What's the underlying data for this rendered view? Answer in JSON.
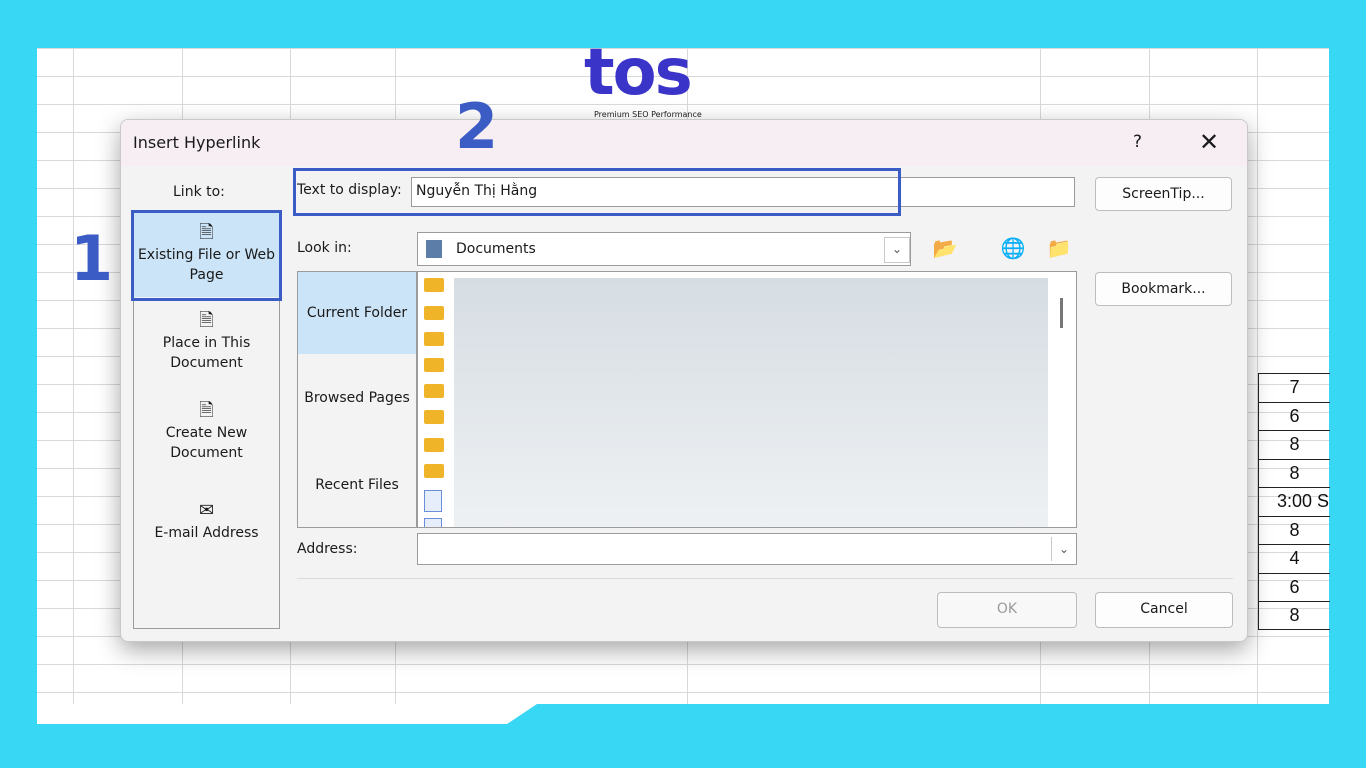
{
  "dialog": {
    "title": "Insert Hyperlink",
    "help": "?",
    "close": "✕",
    "link_to_label": "Link to:",
    "link_items": [
      {
        "label": "Existing File or Web Page",
        "selected": true
      },
      {
        "label": "Place in This Document",
        "selected": false
      },
      {
        "label": "Create New Document",
        "selected": false
      },
      {
        "label": "E-mail Address",
        "selected": false
      }
    ],
    "text_to_display_label": "Text to display:",
    "text_to_display_value": "Nguyễn Thị Hằng",
    "screentip_label": "ScreenTip...",
    "look_in_label": "Look in:",
    "look_in_value": "Documents",
    "bookmark_label": "Bookmark...",
    "nav": {
      "current_folder": "Current Folder",
      "browsed_pages": "Browsed Pages",
      "recent_files": "Recent Files"
    },
    "address_label": "Address:",
    "address_value": "",
    "ok_label": "OK",
    "cancel_label": "Cancel"
  },
  "annotations": {
    "step1": "1",
    "step2": "2"
  },
  "logo": {
    "text": "tos",
    "tagline": "Premium SEO Performance"
  },
  "sheet_values": [
    "7",
    "6",
    "8",
    "8",
    "3:00 S",
    "8",
    "4",
    "6",
    "8"
  ],
  "colors": {
    "background": "#38d7f4",
    "highlight_border": "#3b5cc4",
    "selected_item": "#cce4f7"
  }
}
